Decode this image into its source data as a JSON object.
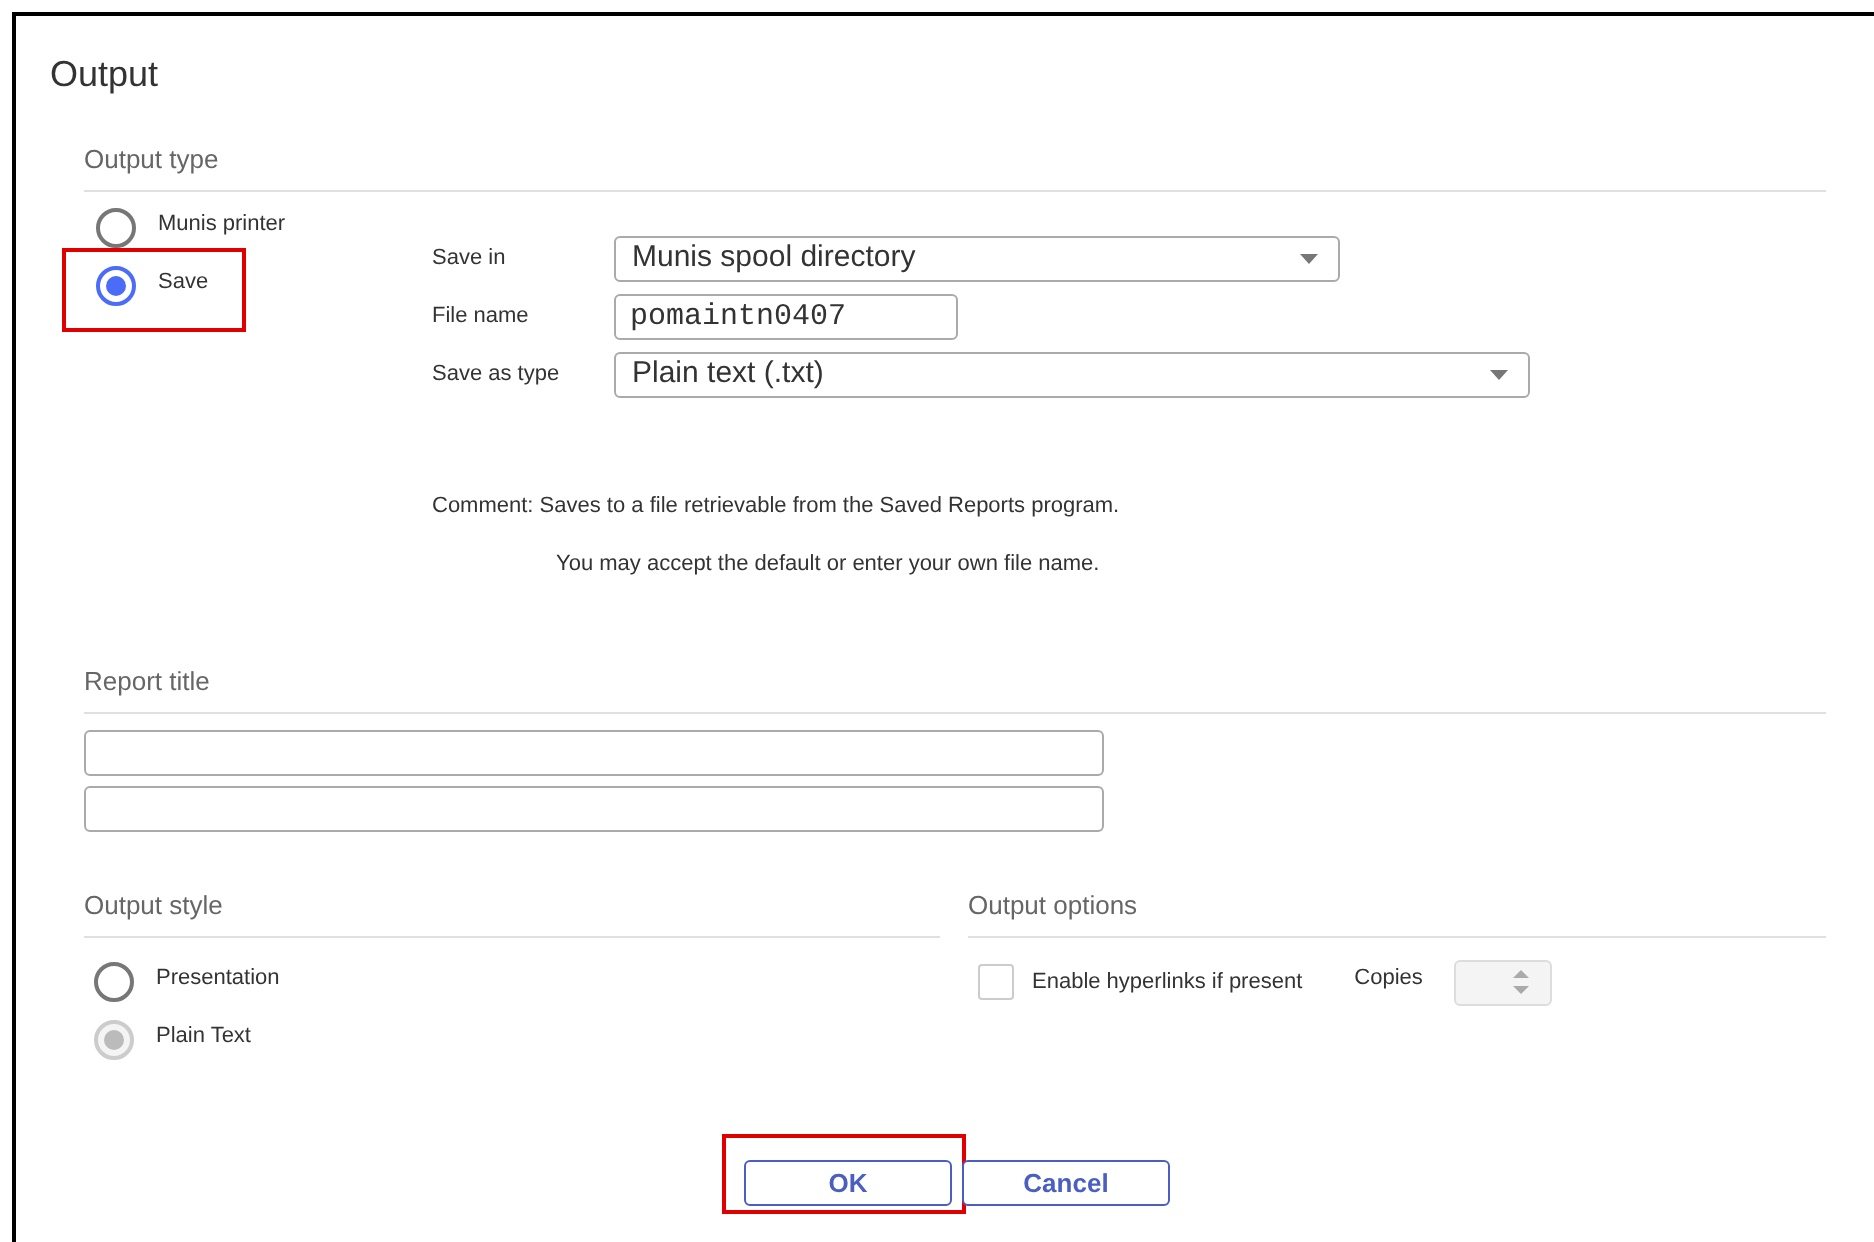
{
  "window": {
    "title": "Output"
  },
  "output_type": {
    "heading": "Output type",
    "options": [
      {
        "label": "Munis printer",
        "selected": false,
        "highlighted": false
      },
      {
        "label": "Save",
        "selected": true,
        "highlighted": true
      }
    ],
    "fields": [
      {
        "kind": "select",
        "label": "Save in",
        "value": "Munis spool directory"
      },
      {
        "kind": "input",
        "label": "File name",
        "value": "pomaintn0407"
      },
      {
        "kind": "select",
        "label": "Save as type",
        "value": "Plain text (.txt)"
      }
    ],
    "comment": [
      "Comment: Saves to a file retrievable from the Saved Reports program.",
      "You may accept the default or enter your own file name."
    ]
  },
  "report_title": {
    "heading": "Report title"
  },
  "output_style": {
    "heading": "Output style",
    "options": [
      {
        "label": "Presentation",
        "selected": false,
        "disabled": false
      },
      {
        "label": "Plain Text",
        "selected": true,
        "disabled": true
      }
    ]
  },
  "output_options": {
    "heading": "Output options",
    "hyperlinks": {
      "label": "Enable hyperlinks if present",
      "checked": false
    },
    "copies": {
      "label": "Copies"
    }
  },
  "buttons": [
    {
      "label": "OK",
      "highlighted": true
    },
    {
      "label": "Cancel",
      "highlighted": false
    }
  ]
}
